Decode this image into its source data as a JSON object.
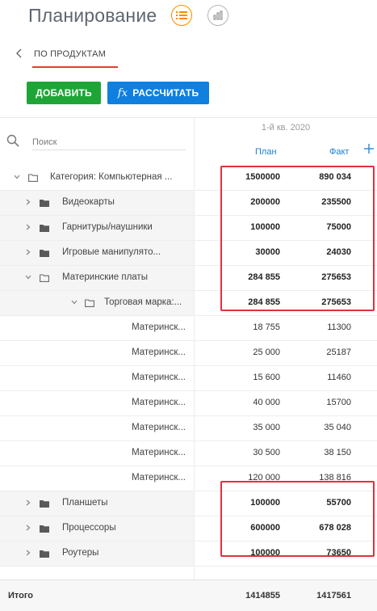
{
  "header": {
    "title": "Планирование",
    "view_buttons": [
      {
        "icon": "list-icon",
        "active": true
      },
      {
        "icon": "bar-chart-icon",
        "active": false
      }
    ]
  },
  "tab": {
    "label": "ПО ПРОДУКТАМ"
  },
  "toolbar": {
    "add_label": "ДОБАВИТЬ",
    "calc_prefix": "fx",
    "calc_label": "РАССЧИТАТЬ"
  },
  "search": {
    "placeholder": "Поиск"
  },
  "columns": {
    "period": "1-й кв. 2020",
    "plan": "План",
    "fact": "Факт"
  },
  "rows": [
    {
      "name": "Категория: Компьютерная ...",
      "plan": "1500000",
      "fact": "890 034"
    },
    {
      "name": "Видеокарты",
      "plan": "200000",
      "fact": "235500"
    },
    {
      "name": "Гарнитуры/наушники",
      "plan": "100000",
      "fact": "75000"
    },
    {
      "name": "Игровые манипулято...",
      "plan": "30000",
      "fact": "24030"
    },
    {
      "name": "Материнские платы",
      "plan": "284 855",
      "fact": "275653"
    },
    {
      "name": "Торговая марка:...",
      "plan": "284 855",
      "fact": "275653"
    },
    {
      "name": "Материнск...",
      "plan": "18 755",
      "fact": "11300"
    },
    {
      "name": "Материнск...",
      "plan": "25 000",
      "fact": "25187"
    },
    {
      "name": "Материнск...",
      "plan": "15 600",
      "fact": "11460"
    },
    {
      "name": "Материнск...",
      "plan": "40 000",
      "fact": "15700"
    },
    {
      "name": "Материнск...",
      "plan": "35 000",
      "fact": "35 040"
    },
    {
      "name": "Материнск...",
      "plan": "30 500",
      "fact": "38 150"
    },
    {
      "name": "Материнск...",
      "plan": "120 000",
      "fact": "138 816"
    },
    {
      "name": "Планшеты",
      "plan": "100000",
      "fact": "55700"
    },
    {
      "name": "Процессоры",
      "plan": "600000",
      "fact": "678 028"
    },
    {
      "name": "Роутеры",
      "plan": "100000",
      "fact": "73650"
    }
  ],
  "total": {
    "label": "Итого",
    "plan": "1414855",
    "fact": "1417561"
  },
  "colors": {
    "accent_orange": "#ff8800",
    "add_green": "#1fa536",
    "calc_blue": "#0f7fe0",
    "tab_underline": "#e4402b",
    "highlight_red": "#e0313e",
    "column_header_blue": "#1b7fd6"
  }
}
